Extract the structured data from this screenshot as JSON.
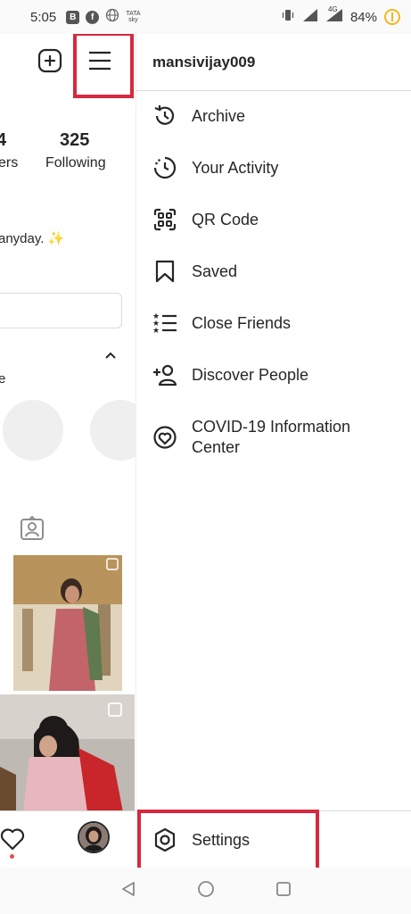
{
  "status_bar": {
    "time": "5:05",
    "badge_b": "B",
    "badge_f": "f",
    "carrier_line1": "TATA",
    "carrier_line2": "sky",
    "signal_4g": "4G",
    "battery_percent": "84%"
  },
  "profile": {
    "followers_count_partial": "4",
    "followers_label_partial": "ers",
    "following_count": "325",
    "following_label": "Following",
    "bio_partial": "anyday. ✨",
    "highlights_label_partial": "e"
  },
  "drawer": {
    "username": "mansivijay009",
    "items": [
      {
        "label": "Archive",
        "icon": "archive-icon"
      },
      {
        "label": "Your Activity",
        "icon": "activity-icon"
      },
      {
        "label": "QR Code",
        "icon": "qr-code-icon"
      },
      {
        "label": "Saved",
        "icon": "bookmark-icon"
      },
      {
        "label": "Close Friends",
        "icon": "close-friends-icon"
      },
      {
        "label": "Discover People",
        "icon": "add-person-icon"
      },
      {
        "label": "COVID-19 Information Center",
        "icon": "covid-info-icon"
      }
    ],
    "settings_label": "Settings"
  },
  "colors": {
    "highlight": "#d6293f",
    "text": "#262626",
    "divider": "#dbdbdb",
    "notification_dot": "#ed4956"
  }
}
